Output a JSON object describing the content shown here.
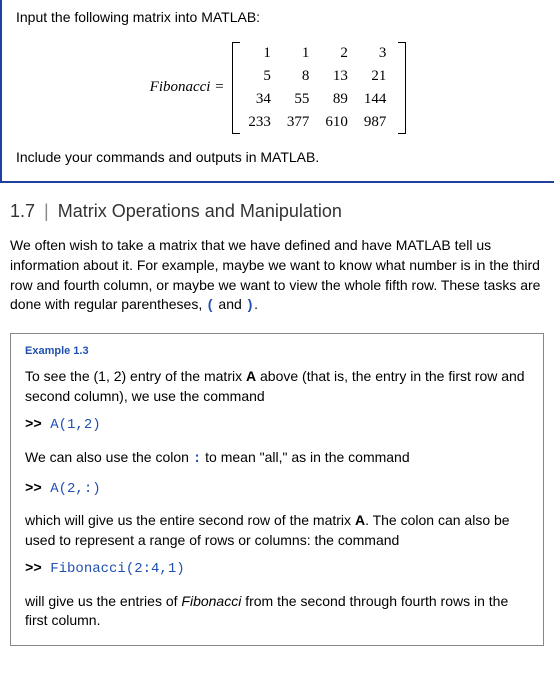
{
  "problem": {
    "intro": "Input the following matrix into MATLAB:",
    "label": "Fibonacci =",
    "matrix": {
      "r1": {
        "c1": "1",
        "c2": "1",
        "c3": "2",
        "c4": "3"
      },
      "r2": {
        "c1": "5",
        "c2": "8",
        "c3": "13",
        "c4": "21"
      },
      "r3": {
        "c1": "34",
        "c2": "55",
        "c3": "89",
        "c4": "144"
      },
      "r4": {
        "c1": "233",
        "c2": "377",
        "c3": "610",
        "c4": "987"
      }
    },
    "close": "Include your commands and outputs in MATLAB."
  },
  "section": {
    "num": "1.7",
    "div": "|",
    "title": "Matrix Operations and Manipulation"
  },
  "intro_para": {
    "t1": "We often wish to take a matrix that we have defined and have MATLAB tell us information about it. For example, maybe we want to know what number is in the third row and fourth column, or maybe we want to view the whole fifth row. These tasks are done with regular parentheses, ",
    "p1": "(",
    "t2": " and ",
    "p2": ")",
    "t3": "."
  },
  "example": {
    "label": "Example 1.3",
    "p1a": "To see the (1, 2) entry of the matrix ",
    "p1b": "A",
    "p1c": " above (that is, the entry in the first row and second column), we use the command",
    "cmd1_prompt": ">>",
    "cmd1": " A(1,2)",
    "p2a": "We can also use the colon ",
    "p2colon": ":",
    "p2b": " to mean \"all,\" as in the command",
    "cmd2_prompt": ">>",
    "cmd2": " A(2,:)",
    "p3a": "which will give us the entire second row of the matrix ",
    "p3b": "A",
    "p3c": ". The colon can also be used to represent a range of rows or columns: the command",
    "cmd3_prompt": ">>",
    "cmd3": " Fibonacci(2:4,1)",
    "p4a": "will give us the entries of ",
    "p4b": "Fibonacci",
    "p4c": " from the second through fourth rows in the first column."
  }
}
